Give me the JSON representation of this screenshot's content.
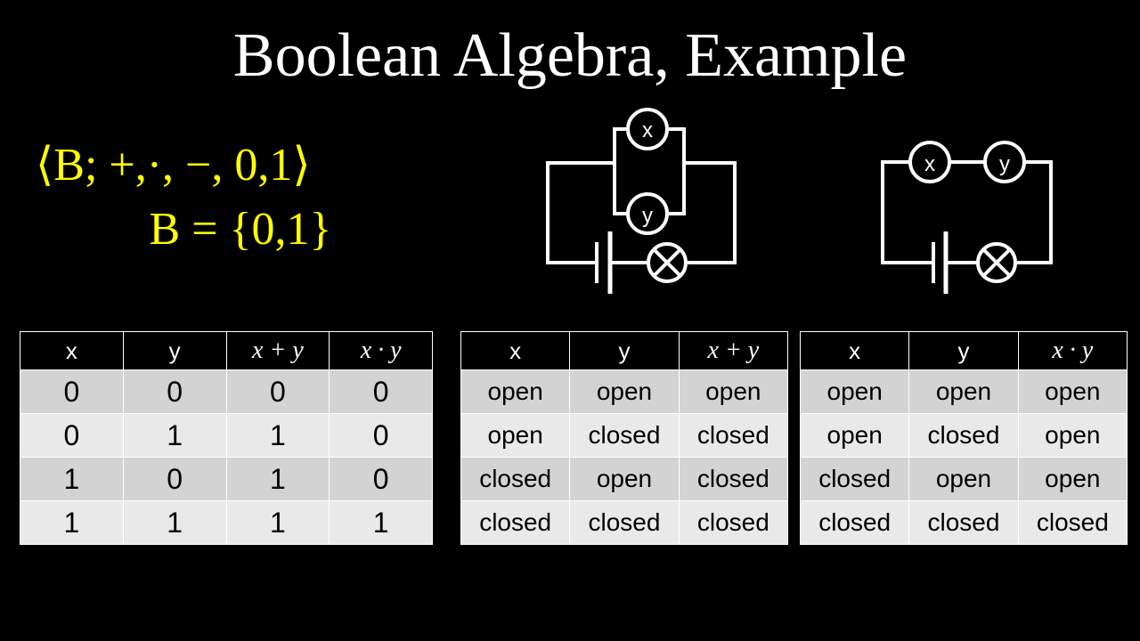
{
  "title": "Boolean Algebra, Example",
  "formula": {
    "line1": "⟨B;  +,·, −, 0,1⟩",
    "line2": "B = {0,1}",
    "color": "#ffff00"
  },
  "circuits": [
    {
      "name": "parallel-circuit",
      "switch_top_label": "x",
      "switch_bottom_label": "y",
      "lamp_label": "",
      "topology": "parallel"
    },
    {
      "name": "series-circuit",
      "switch_left_label": "x",
      "switch_right_label": "y",
      "lamp_label": "",
      "topology": "series"
    }
  ],
  "tables": [
    {
      "name": "binary-truth-table",
      "headers": [
        "x",
        "y",
        "x + y",
        "x · y"
      ],
      "header_styles": [
        "plain",
        "plain",
        "math",
        "math"
      ],
      "rows": [
        [
          "0",
          "0",
          "0",
          "0"
        ],
        [
          "0",
          "1",
          "1",
          "0"
        ],
        [
          "1",
          "0",
          "1",
          "0"
        ],
        [
          "1",
          "1",
          "1",
          "1"
        ]
      ]
    },
    {
      "name": "parallel-switch-table",
      "headers": [
        "x",
        "y",
        "x + y"
      ],
      "header_styles": [
        "plain",
        "plain",
        "math"
      ],
      "rows": [
        [
          "open",
          "open",
          "open"
        ],
        [
          "open",
          "closed",
          "closed"
        ],
        [
          "closed",
          "open",
          "closed"
        ],
        [
          "closed",
          "closed",
          "closed"
        ]
      ]
    },
    {
      "name": "series-switch-table",
      "headers": [
        "x",
        "y",
        "x · y"
      ],
      "header_styles": [
        "plain",
        "plain",
        "math"
      ],
      "rows": [
        [
          "open",
          "open",
          "open"
        ],
        [
          "open",
          "closed",
          "open"
        ],
        [
          "closed",
          "open",
          "open"
        ],
        [
          "closed",
          "closed",
          "closed"
        ]
      ]
    }
  ],
  "colors": {
    "background": "#000000",
    "title": "#ffffff",
    "formula": "#ffff00",
    "table_header_bg": "#000000",
    "table_row_odd": "#d3d3d3",
    "table_row_even": "#e9e9e9",
    "wire": "#ffffff"
  }
}
